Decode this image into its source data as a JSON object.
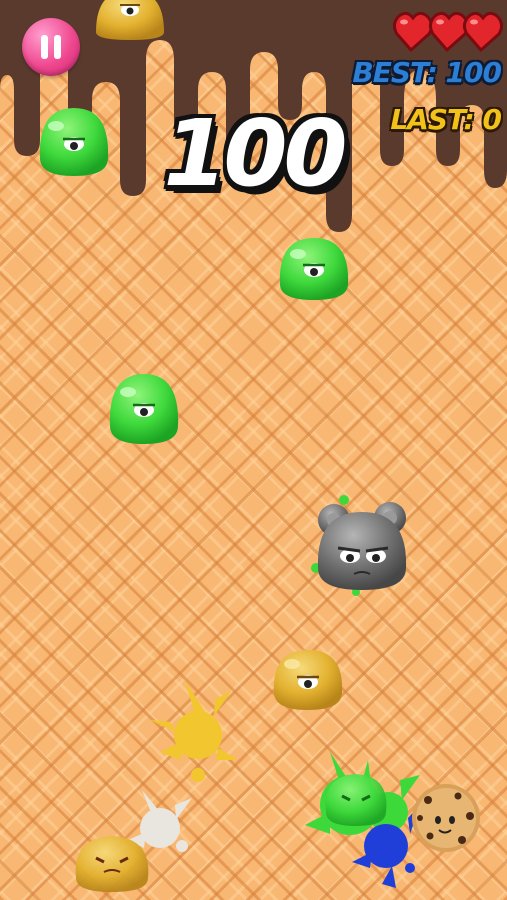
{
  "hud": {
    "score": "100",
    "best_label": "BEST: 100",
    "last_label": "LAST: 0",
    "lives": 3,
    "pause_icon": "pause-icon"
  },
  "colors": {
    "chocolate": "#5b3a2e",
    "waffle": "#f8b873",
    "green_jelly": "#3fd93c",
    "yellow_jelly": "#e3b12f",
    "gray_jelly": "#6f6f6f",
    "heart": "#e2262c",
    "best": "#2d7fd6",
    "last": "#f2c21b"
  },
  "sprites": {
    "jellies": [
      {
        "name": "yellow-jelly-top",
        "color": "yellow"
      },
      {
        "name": "green-jelly-left",
        "color": "green"
      },
      {
        "name": "green-jelly-right",
        "color": "green"
      },
      {
        "name": "green-jelly-middle",
        "color": "green"
      },
      {
        "name": "gray-eared-jelly",
        "color": "gray"
      },
      {
        "name": "yellow-jelly-bottom",
        "color": "yellow"
      },
      {
        "name": "squashed-yellow-jelly",
        "color": "yellow"
      },
      {
        "name": "squashed-green-jelly",
        "color": "green"
      }
    ],
    "splats": [
      "yellow-splat",
      "white-splat",
      "green-splat",
      "blue-splat"
    ],
    "cookie": "cookie-character"
  }
}
